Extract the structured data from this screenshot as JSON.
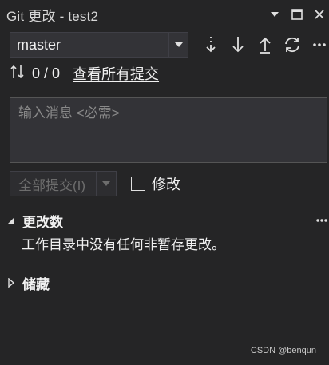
{
  "window": {
    "title": "Git 更改 - test2",
    "icons": [
      "dropdown-triangle-icon",
      "maximize-icon",
      "close-icon"
    ]
  },
  "branch": {
    "selected": "master",
    "toolbar_icons": [
      "fetch-icon",
      "pull-icon",
      "push-icon",
      "sync-icon",
      "more-icon"
    ]
  },
  "sync": {
    "counts": "0 / 0",
    "view_all_commits": "查看所有提交"
  },
  "commit_message": {
    "placeholder": "输入消息 <必需>",
    "value": ""
  },
  "commit": {
    "button_label": "全部提交(I)",
    "amend_label": "修改",
    "amend_checked": false
  },
  "sections": {
    "changes": {
      "heading": "更改数",
      "empty_text": "工作目录中没有任何非暂存更改。",
      "expanded": true
    },
    "stashes": {
      "heading": "储藏",
      "expanded": false
    }
  },
  "watermark": "CSDN @benqun",
  "colors": {
    "background": "#252526",
    "input_bg": "#333337",
    "text": "#f1f1f1",
    "disabled_text": "#6d6d6d"
  }
}
